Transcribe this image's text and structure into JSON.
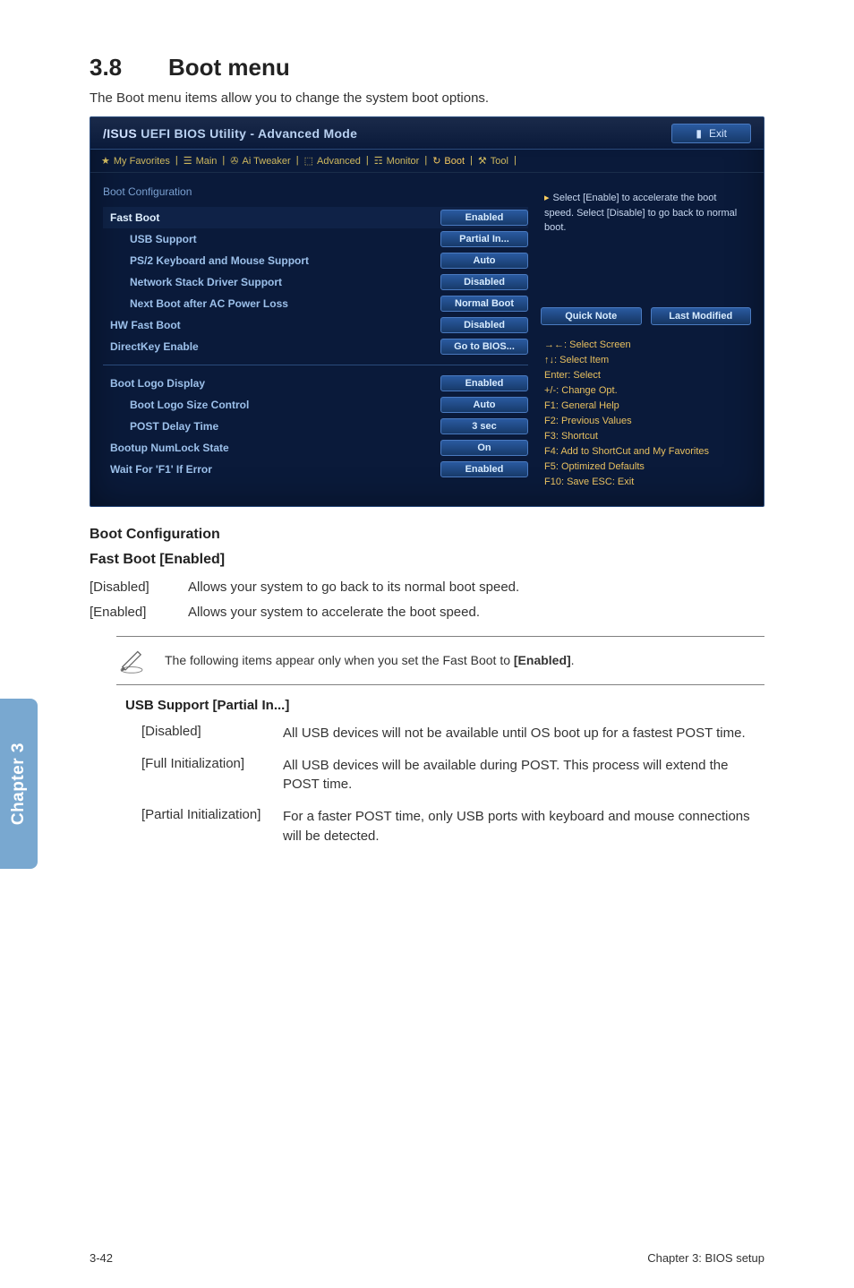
{
  "section": {
    "number": "3.8",
    "title": "Boot menu"
  },
  "section_desc": "The Boot menu items allow you to change the system boot options.",
  "bios": {
    "brand": "/ISUS",
    "title": "UEFI BIOS Utility - Advanced Mode",
    "exit": "Exit",
    "tabs": {
      "fav": "My Favorites",
      "main": "Main",
      "tweaker": "Ai Tweaker",
      "advanced": "Advanced",
      "monitor": "Monitor",
      "boot": "Boot",
      "tool": "Tool"
    },
    "section_label": "Boot Configuration",
    "rows": {
      "fast_boot": {
        "label": "Fast Boot",
        "value": "Enabled"
      },
      "usb_support": {
        "label": "USB Support",
        "value": "Partial In..."
      },
      "ps2": {
        "label": "PS/2 Keyboard and Mouse Support",
        "value": "Auto"
      },
      "network": {
        "label": "Network Stack Driver Support",
        "value": "Disabled"
      },
      "next_boot": {
        "label": "Next Boot after AC Power Loss",
        "value": "Normal Boot"
      },
      "hw_fast": {
        "label": "HW Fast Boot",
        "value": "Disabled"
      },
      "directkey": {
        "label": "DirectKey Enable",
        "value": "Go to BIOS..."
      },
      "boot_logo": {
        "label": "Boot Logo Display",
        "value": "Enabled"
      },
      "boot_logo_size": {
        "label": "Boot Logo Size Control",
        "value": "Auto"
      },
      "post_delay": {
        "label": "POST Delay Time",
        "value": "3 sec"
      },
      "numlock": {
        "label": "Bootup NumLock State",
        "value": "On"
      },
      "wait_f1": {
        "label": "Wait For 'F1' If Error",
        "value": "Enabled"
      }
    },
    "help_text": "Select [Enable] to accelerate the boot speed. Select [Disable] to go back to normal boot.",
    "quick_note": "Quick Note",
    "last_modified": "Last Modified",
    "keys": {
      "k1": "→←: Select Screen",
      "k2": "↑↓: Select Item",
      "k3": "Enter: Select",
      "k4": "+/-: Change Opt.",
      "k5": "F1: General Help",
      "k6": "F2: Previous Values",
      "k7": "F3: Shortcut",
      "k8": "F4: Add to ShortCut and My Favorites",
      "k9": "F5: Optimized Defaults",
      "k10": "F10: Save  ESC: Exit"
    }
  },
  "subsec1": "Boot Configuration",
  "subsec2": "Fast Boot [Enabled]",
  "defs": {
    "disabled": {
      "k": "[Disabled]",
      "v": "Allows your system to go back to its normal boot speed."
    },
    "enabled": {
      "k": "[Enabled]",
      "v": "Allows your system to accelerate the boot speed."
    }
  },
  "note": {
    "text_pre": "The following items appear only when you set the Fast Boot to ",
    "bold": "[Enabled]",
    "text_post": "."
  },
  "usb_heading": "USB Support [Partial In...]",
  "usb_defs": {
    "disabled": {
      "k": "[Disabled]",
      "v": "All USB devices will not be available until OS boot up for a fastest POST time."
    },
    "full": {
      "k": "[Full Initialization]",
      "v": "All USB devices will be available during POST. This process will extend the POST time."
    },
    "partial": {
      "k": "[Partial Initialization]",
      "v": "For a faster POST time, only USB ports with keyboard and mouse connections will be detected."
    }
  },
  "chapter_tab": "Chapter 3",
  "footer": {
    "left": "3-42",
    "right": "Chapter 3: BIOS setup"
  }
}
